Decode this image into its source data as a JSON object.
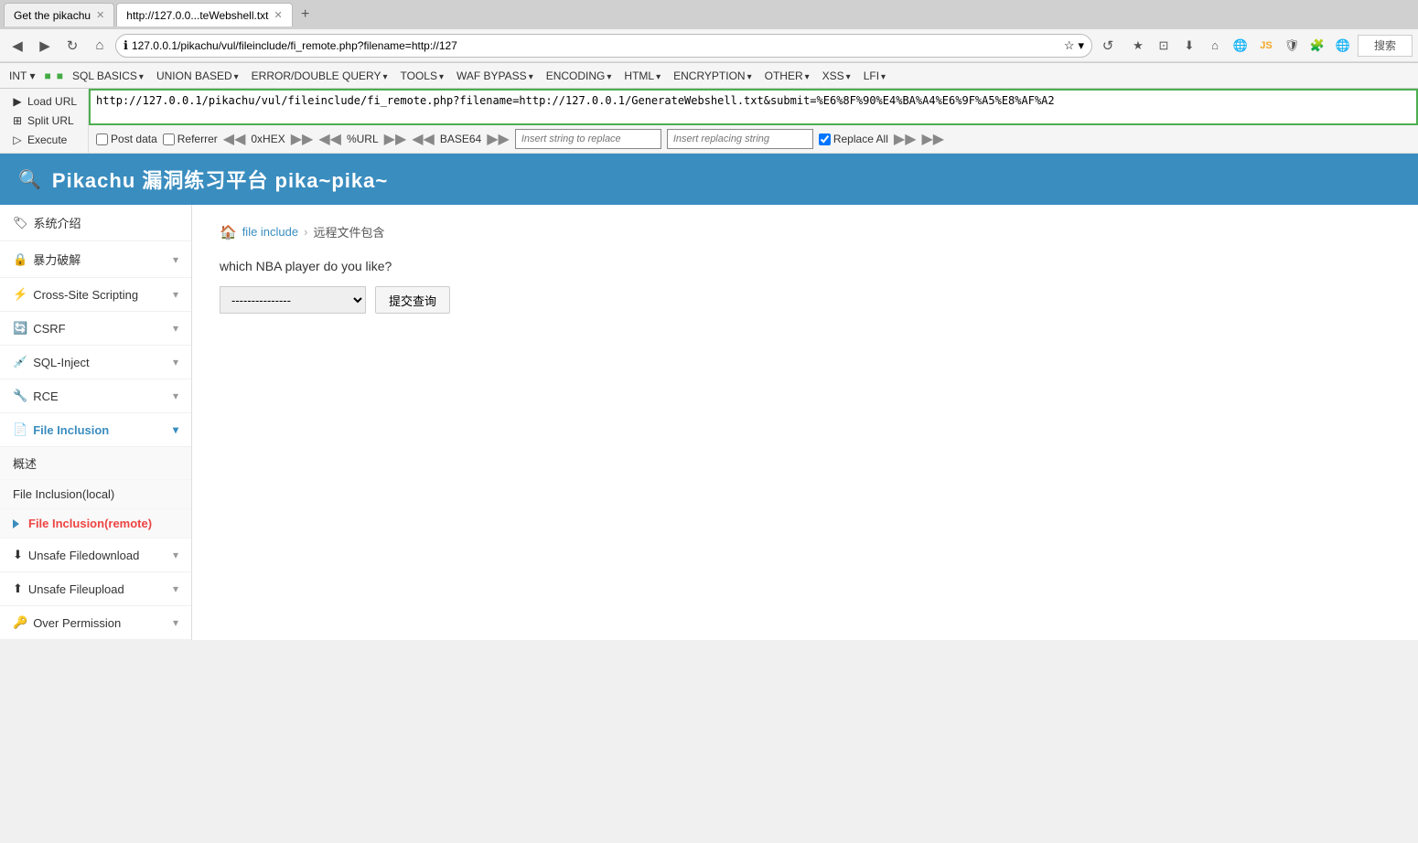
{
  "browser": {
    "tabs": [
      {
        "id": "tab1",
        "title": "Get the pikachu",
        "url": "",
        "active": false
      },
      {
        "id": "tab2",
        "title": "http://127.0.0...teWebshell.txt",
        "url": "http://127.0.0.1/pikachu/vul/fileinclude/fi_remote.php?filename=http://127.0.0.1/GenerateWebshell.txt&submit=%E6%8F%90%E4%BA%A4%E6%9F%A5%E8%AF%A2",
        "active": true
      }
    ],
    "address": "127.0.0.1/pikachu/vul/fileinclude/fi_remote.php?filename=http://127",
    "search_placeholder": "搜索"
  },
  "hackbar": {
    "menus": [
      "INT",
      "SQL BASICS",
      "UNION BASED",
      "ERROR/DOUBLE QUERY",
      "TOOLS",
      "WAF BYPASS",
      "ENCODING",
      "HTML",
      "ENCRYPTION",
      "OTHER",
      "XSS",
      "LFI"
    ],
    "sidebar_items": [
      {
        "id": "load-url",
        "label": "Load URL"
      },
      {
        "id": "split-url",
        "label": "Split URL"
      },
      {
        "id": "execute",
        "label": "Execute"
      }
    ],
    "url_value": "http://127.0.0.1/pikachu/vul/fileinclude/fi_remote.php?filename=http://127.0.0.1/GenerateWebshell.txt&submit=%E6%8F%90%E4%BA%A4%E6%9F%A5%E8%AF%A2",
    "checkboxes": [
      {
        "id": "post-data",
        "label": "Post data",
        "checked": false
      },
      {
        "id": "referrer",
        "label": "Referrer",
        "checked": false
      }
    ],
    "encode_buttons": [
      "0xHEX",
      "%URL",
      "BASE64"
    ],
    "insert_string_placeholder": "Insert string to replace",
    "insert_replacing_placeholder": "Insert replacing string",
    "replace_all_label": "Replace All",
    "replace_all_checked": true
  },
  "app": {
    "title": "Pikachu 漏洞练习平台 pika~pika~",
    "header_icon": "🔍"
  },
  "sidebar": {
    "items": [
      {
        "id": "sys-intro",
        "label": "系统介绍",
        "icon": "🏷",
        "active": false,
        "expandable": false
      },
      {
        "id": "brute-force",
        "label": "暴力破解",
        "icon": "🔒",
        "active": false,
        "expandable": true
      },
      {
        "id": "cross-site",
        "label": "Cross-Site Scripting",
        "icon": "⚡",
        "active": false,
        "expandable": true
      },
      {
        "id": "csrf",
        "label": "CSRF",
        "icon": "🔄",
        "active": false,
        "expandable": true
      },
      {
        "id": "sql-inject",
        "label": "SQL-Inject",
        "icon": "💉",
        "active": false,
        "expandable": true
      },
      {
        "id": "rce",
        "label": "RCE",
        "icon": "🔧",
        "active": false,
        "expandable": true
      },
      {
        "id": "file-inclusion",
        "label": "File Inclusion",
        "icon": "📄",
        "active": true,
        "expandable": true,
        "sub_items": [
          {
            "id": "overview",
            "label": "概述",
            "active": false
          },
          {
            "id": "file-inclusion-local",
            "label": "File Inclusion(local)",
            "active": false
          },
          {
            "id": "file-inclusion-remote",
            "label": "File Inclusion(remote)",
            "active": true
          }
        ]
      },
      {
        "id": "unsafe-filedownload",
        "label": "Unsafe Filedownload",
        "icon": "⬇",
        "active": false,
        "expandable": true
      },
      {
        "id": "unsafe-fileupload",
        "label": "Unsafe Fileupload",
        "icon": "⬆",
        "active": false,
        "expandable": true
      },
      {
        "id": "over-permission",
        "label": "Over Permission",
        "icon": "🔑",
        "active": false,
        "expandable": true
      }
    ]
  },
  "main": {
    "breadcrumb": {
      "home_icon": "🏠",
      "items": [
        {
          "label": "file include",
          "link": true
        },
        {
          "label": "远程文件包含",
          "link": false
        }
      ],
      "separator": "›"
    },
    "question": "which NBA player do you like?",
    "select_default": "---------------",
    "select_options": [
      "---------------"
    ],
    "submit_label": "提交查询"
  }
}
